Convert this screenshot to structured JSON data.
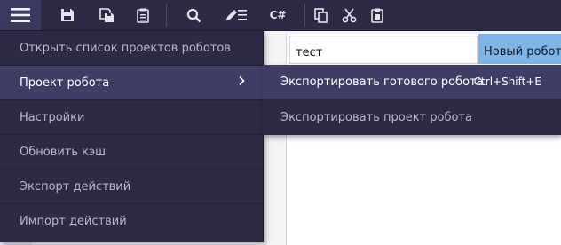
{
  "toolbar": {
    "icons": [
      "menu-icon",
      "save-icon",
      "save-as-icon",
      "clipboard-list-icon",
      "search-icon",
      "edit-list-icon",
      "csharp-icon",
      "copy-icon",
      "cut-icon",
      "paste-icon"
    ],
    "csharp_label": "C#"
  },
  "editor": {
    "name_value": "тест",
    "tab_label": "Новый робот"
  },
  "main_menu": {
    "items": [
      {
        "label": "Открыть список проектов роботов"
      },
      {
        "label": "Проект робота"
      },
      {
        "label": "Настройки"
      },
      {
        "label": "Обновить кэш"
      },
      {
        "label": "Экспорт действий"
      },
      {
        "label": "Импорт действий"
      }
    ],
    "active_index": 1
  },
  "sub_menu": {
    "items": [
      {
        "label": "Экспортировать готового робота",
        "shortcut": "Ctrl+Shift+E"
      },
      {
        "label": "Экспортировать проект робота",
        "shortcut": ""
      }
    ]
  },
  "colors": {
    "menu_bg": "#2c2a45",
    "menu_active": "#3f3d63",
    "tab_accent": "#7fb4e6"
  }
}
